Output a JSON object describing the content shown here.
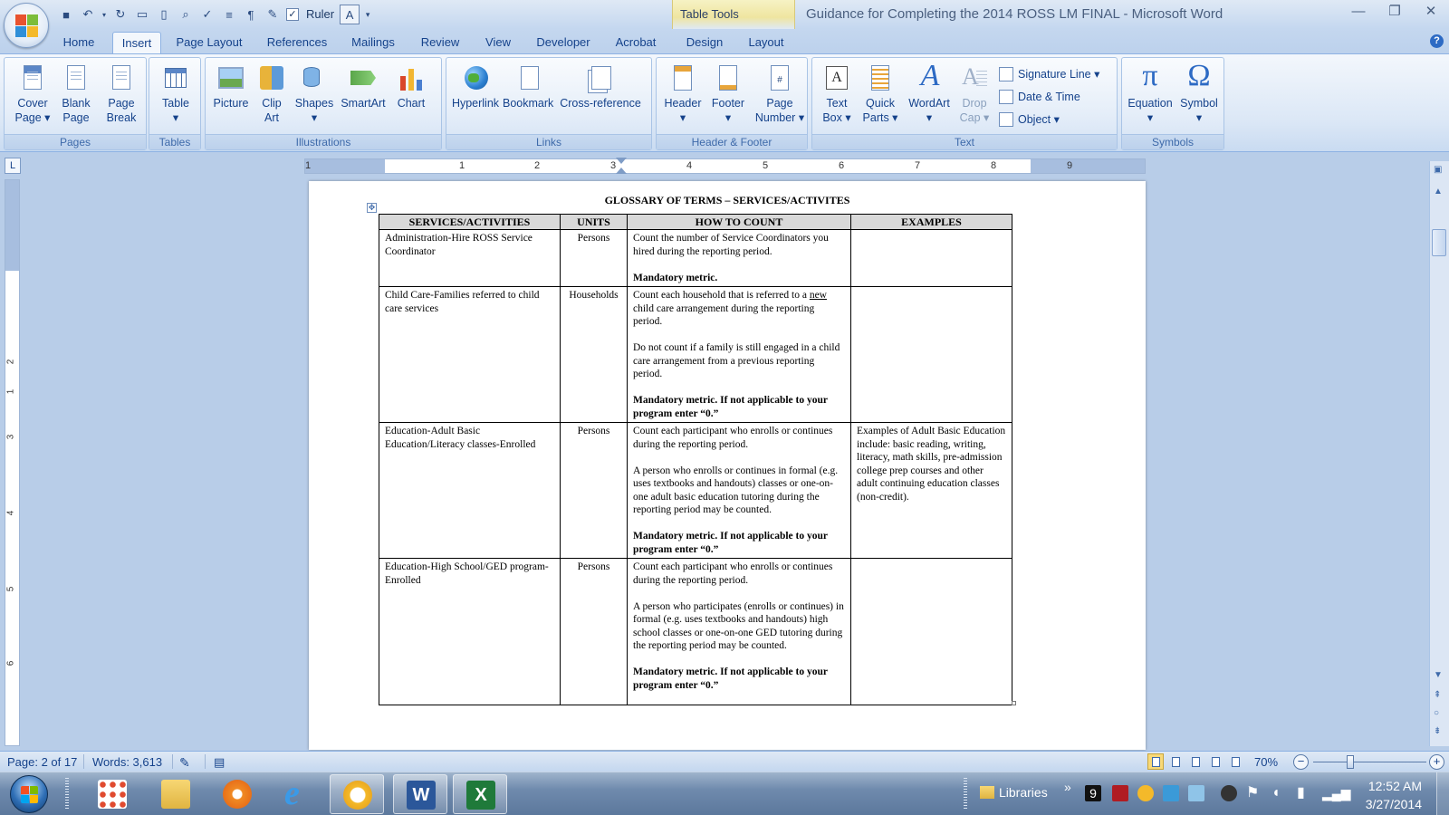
{
  "app": {
    "window_title": "Guidance for Completing the 2014 ROSS LM FINAL - Microsoft Word",
    "context_tab_label": "Table Tools"
  },
  "qat": {
    "ruler_label": "Ruler"
  },
  "tabs": [
    "Home",
    "Insert",
    "Page Layout",
    "References",
    "Mailings",
    "Review",
    "View",
    "Developer",
    "Acrobat",
    "Design",
    "Layout"
  ],
  "active_tab": "Insert",
  "ribbon": {
    "groups": {
      "pages": "Pages",
      "tables": "Tables",
      "illustrations": "Illustrations",
      "links": "Links",
      "header_footer": "Header & Footer",
      "text": "Text",
      "symbols": "Symbols"
    },
    "buttons": {
      "cover_page": "Cover\nPage ▾",
      "blank_page": "Blank\nPage",
      "page_break": "Page\nBreak",
      "table": "Table\n▾",
      "picture": "Picture",
      "clip_art": "Clip\nArt",
      "shapes": "Shapes\n▾",
      "smartart": "SmartArt",
      "chart": "Chart",
      "hyperlink": "Hyperlink",
      "bookmark": "Bookmark",
      "cross_reference": "Cross-reference",
      "header": "Header\n▾",
      "footer": "Footer\n▾",
      "page_number": "Page\nNumber ▾",
      "text_box": "Text\nBox ▾",
      "quick_parts": "Quick\nParts ▾",
      "wordart": "WordArt\n▾",
      "drop_cap": "Drop\nCap ▾",
      "signature_line": "Signature Line ▾",
      "date_time": "Date & Time",
      "object": "Object ▾",
      "equation": "Equation\n▾",
      "symbol": "Symbol\n▾"
    }
  },
  "ruler": {
    "corner": "L",
    "h_numbers": [
      "1",
      "1",
      "2",
      "3",
      "4",
      "5",
      "6",
      "7",
      "8",
      "9"
    ],
    "v_numbers": [
      "1",
      "2",
      "3",
      "4",
      "5",
      "6"
    ]
  },
  "document": {
    "title": "GLOSSARY OF TERMS – SERVICES/ACTIVITES",
    "table": {
      "headers": [
        "SERVICES/ACTIVITIES",
        "UNITS",
        "HOW TO COUNT",
        "EXAMPLES"
      ],
      "rows": [
        {
          "service": "Administration-Hire ROSS Service Coordinator",
          "units": "Persons",
          "count_p1": "Count the number of Service Coordinators you hired during the reporting period.",
          "count_bold": "Mandatory metric.",
          "examples": ""
        },
        {
          "service": "Child Care-Families referred to child care services",
          "units": "Households",
          "count_p1_pre": "Count each household that is referred to a",
          "count_p1_underline": "new",
          "count_p1_post": "child care arrangement during the reporting period.",
          "count_p2": "Do not count if a family is still engaged in a child care arrangement from a previous reporting period.",
          "count_bold": "Mandatory metric. If not applicable to your program enter “0.”",
          "examples": ""
        },
        {
          "service": "Education-Adult Basic Education/Literacy classes-Enrolled",
          "units": "Persons",
          "count_p1": "Count each participant who enrolls or continues during the reporting period.",
          "count_p2": "A person who enrolls or continues in formal (e.g. uses textbooks and handouts) classes or one-on-one adult basic education tutoring during the reporting period may be counted.",
          "count_bold": "Mandatory metric. If not applicable to your program enter “0.”",
          "examples": "Examples of Adult Basic Education include: basic reading, writing, literacy, math skills, pre-admission college prep courses and other adult continuing education classes (non-credit)."
        },
        {
          "service": "Education-High School/GED program-Enrolled",
          "units": "Persons",
          "count_p1": "Count each participant who enrolls or continues during the reporting period.",
          "count_p2": "A person who participates (enrolls or continues) in formal (e.g. uses textbooks and handouts) high school classes or one-on-one GED tutoring during the reporting period may be counted.",
          "count_bold": "Mandatory metric. If not applicable to your program enter “0.”",
          "examples": ""
        }
      ]
    }
  },
  "status": {
    "page": "Page: 2 of 17",
    "words": "Words: 3,613",
    "zoom": "70%",
    "zoom_out": "−",
    "zoom_in": "+"
  },
  "taskbar": {
    "libraries": "Libraries",
    "overflow": "»",
    "tray_badge": "9",
    "time": "12:52 AM",
    "date": "3/27/2014"
  },
  "colors": {
    "ribbon_text": "#15428b",
    "context_tab": "#efe5a0",
    "word_blue": "#2b579a",
    "excel_green": "#1f7a3a"
  }
}
